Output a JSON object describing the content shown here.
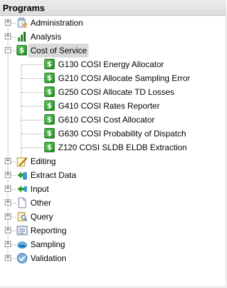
{
  "header": {
    "title": "Programs"
  },
  "tree": {
    "expanded_glyph": "−",
    "collapsed_glyph": "+",
    "dollar_glyph": "$",
    "top_items": [
      {
        "label": "Administration",
        "icon": "admin-icon",
        "expanded": false
      },
      {
        "label": "Analysis",
        "icon": "analysis-chart-icon",
        "expanded": false
      },
      {
        "label": "Cost of Service",
        "icon": "dollar-icon",
        "expanded": true,
        "selected": true
      },
      {
        "label": "Editing",
        "icon": "edit-pencil-icon",
        "expanded": false
      },
      {
        "label": "Extract Data",
        "icon": "extract-data-icon",
        "expanded": false
      },
      {
        "label": "Input",
        "icon": "input-arrow-icon",
        "expanded": false
      },
      {
        "label": "Other",
        "icon": "document-icon",
        "expanded": false
      },
      {
        "label": "Query",
        "icon": "query-icon",
        "expanded": false
      },
      {
        "label": "Reporting",
        "icon": "report-icon",
        "expanded": false
      },
      {
        "label": "Sampling",
        "icon": "sampling-icon",
        "expanded": false
      },
      {
        "label": "Validation",
        "icon": "validation-icon",
        "expanded": false
      }
    ],
    "cost_of_service_children": [
      {
        "label": "G130 COSI Energy Allocator"
      },
      {
        "label": "G210 COSI Allocate Sampling Error"
      },
      {
        "label": "G250 COSI Allocate TD Losses"
      },
      {
        "label": "G410 COSI Rates Reporter"
      },
      {
        "label": "G610 COSI Cost Allocator"
      },
      {
        "label": "G630 COSI Probability of Dispatch"
      },
      {
        "label": "Z120 COSI SLDB ELDB Extraction"
      }
    ]
  },
  "colors": {
    "header_bg": "#e4e4e4",
    "selection_bg": "#d9d9d9",
    "dollar_green": "#2ea02e"
  }
}
